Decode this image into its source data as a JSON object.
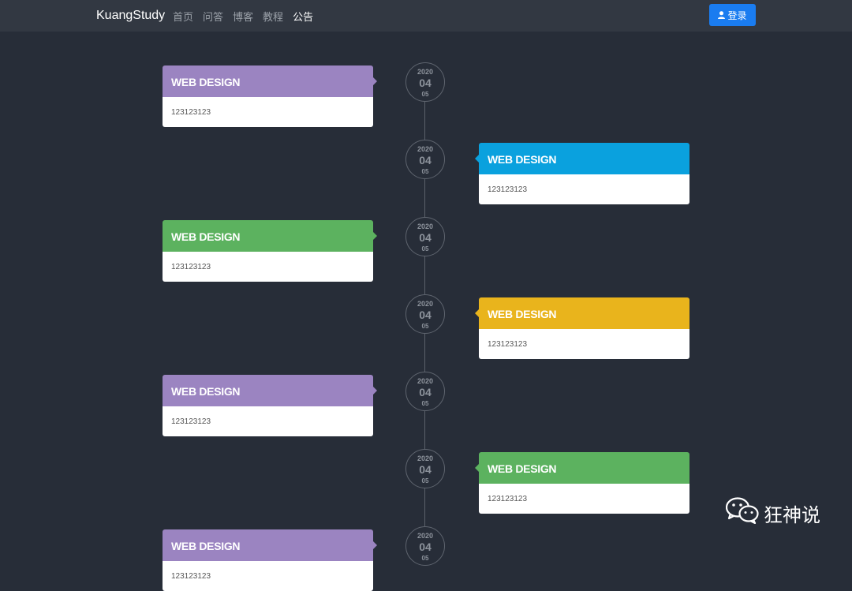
{
  "navbar": {
    "brand": "KuangStudy",
    "links": [
      "首页",
      "问答",
      "博客",
      "教程",
      "公告"
    ],
    "active_index": 4,
    "login_label": "登录"
  },
  "timeline": {
    "items": [
      {
        "side": "left",
        "color": "#9b84c1",
        "title": "WEB DESIGN",
        "text": "123123123",
        "date": {
          "year": "2020",
          "day": "04",
          "month": "05"
        }
      },
      {
        "side": "right",
        "color": "#0aa1de",
        "title": "WEB DESIGN",
        "text": "123123123",
        "date": {
          "year": "2020",
          "day": "04",
          "month": "05"
        }
      },
      {
        "side": "left",
        "color": "#5cb25f",
        "title": "WEB DESIGN",
        "text": "123123123",
        "date": {
          "year": "2020",
          "day": "04",
          "month": "05"
        }
      },
      {
        "side": "right",
        "color": "#e9b41c",
        "title": "WEB DESIGN",
        "text": "123123123",
        "date": {
          "year": "2020",
          "day": "04",
          "month": "05"
        }
      },
      {
        "side": "left",
        "color": "#9b84c1",
        "title": "WEB DESIGN",
        "text": "123123123",
        "date": {
          "year": "2020",
          "day": "04",
          "month": "05"
        }
      },
      {
        "side": "right",
        "color": "#5cb25f",
        "title": "WEB DESIGN",
        "text": "123123123",
        "date": {
          "year": "2020",
          "day": "04",
          "month": "05"
        }
      },
      {
        "side": "left",
        "color": "#9b84c1",
        "title": "WEB DESIGN",
        "text": "123123123",
        "date": {
          "year": "2020",
          "day": "04",
          "month": "05"
        }
      }
    ]
  },
  "watermark": {
    "icon": "wechat-icon",
    "text": "狂神说"
  }
}
